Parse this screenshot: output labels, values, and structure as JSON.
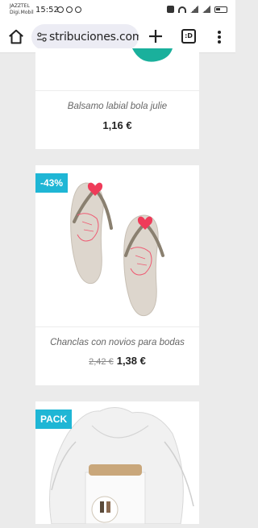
{
  "status_bar": {
    "carrier_line1": "JAZZTEL",
    "carrier_line2": "Digi.Mobil",
    "time": "15:52"
  },
  "browser": {
    "url": "stribuciones.com",
    "tab_count": ":D"
  },
  "products": [
    {
      "name": "Balsamo labial bola julie",
      "price": "1,16 €"
    },
    {
      "name": "Chanclas con novios para bodas",
      "old_price": "2,42 €",
      "price": "1,38 €",
      "badge": "-43%"
    },
    {
      "badge": "PACK"
    }
  ],
  "colors": {
    "badge": "#1fb6d5",
    "flipflop": "#ddd6cd",
    "heart": "#ef3b59"
  }
}
